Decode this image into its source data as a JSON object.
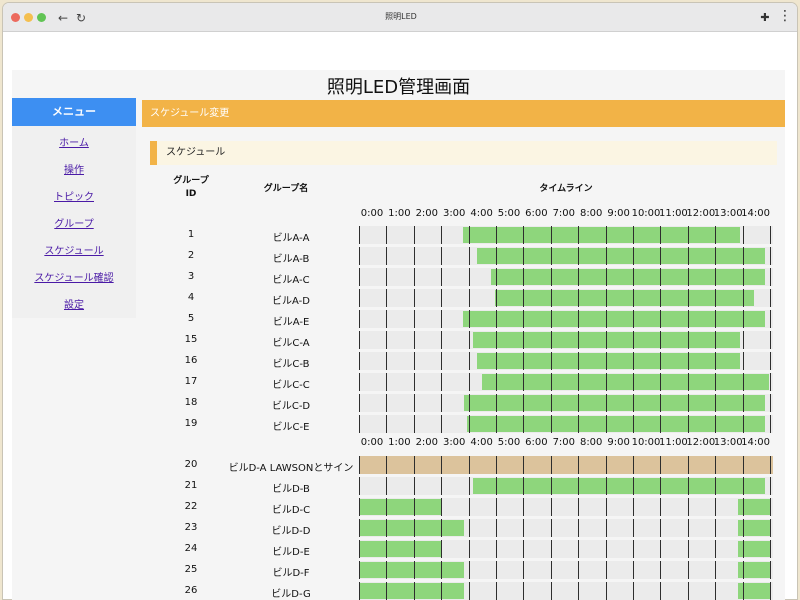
{
  "browser": {
    "title": "照明LED",
    "back_icon": "←",
    "reload_icon": "↻",
    "extension_icon": "✚"
  },
  "page": {
    "title": "照明LED管理画面"
  },
  "sidebar": {
    "heading": "メニュー",
    "items": [
      {
        "label": "ホーム"
      },
      {
        "label": "操作"
      },
      {
        "label": "トピック"
      },
      {
        "label": "グループ"
      },
      {
        "label": "スケジュール"
      },
      {
        "label": "スケジュール確認"
      },
      {
        "label": "設定"
      }
    ]
  },
  "section": {
    "heading": "スケジュール変更",
    "subheading": "スケジュール"
  },
  "table": {
    "col_id_line1": "グループ",
    "col_id_line2": "ID",
    "col_name": "グループ名",
    "col_timeline": "タイムライン",
    "hours": [
      "0:00",
      "1:00",
      "2:00",
      "3:00",
      "4:00",
      "5:00",
      "6:00",
      "7:00",
      "8:00",
      "9:00",
      "10:00",
      "11:00",
      "12:00",
      "13:00",
      "14:00"
    ],
    "group1": [
      {
        "id": "1",
        "name": "ビルA-A",
        "on": [
          {
            "start": 3.8,
            "end": 13.9
          }
        ]
      },
      {
        "id": "2",
        "name": "ビルA-B",
        "on": [
          {
            "start": 4.3,
            "end": 14.8
          }
        ]
      },
      {
        "id": "3",
        "name": "ビルA-C",
        "on": [
          {
            "start": 4.8,
            "end": 14.8
          }
        ]
      },
      {
        "id": "4",
        "name": "ビルA-D",
        "on": [
          {
            "start": 4.95,
            "end": 14.4
          }
        ]
      },
      {
        "id": "5",
        "name": "ビルA-E",
        "on": [
          {
            "start": 3.8,
            "end": 14.8
          }
        ]
      },
      {
        "id": "15",
        "name": "ビルC-A",
        "on": [
          {
            "start": 4.15,
            "end": 13.9
          }
        ]
      },
      {
        "id": "16",
        "name": "ビルC-B",
        "on": [
          {
            "start": 4.3,
            "end": 13.9
          }
        ]
      },
      {
        "id": "17",
        "name": "ビルC-C",
        "on": [
          {
            "start": 4.5,
            "end": 14.95
          }
        ]
      },
      {
        "id": "18",
        "name": "ビルC-D",
        "on": [
          {
            "start": 3.85,
            "end": 14.8
          }
        ]
      },
      {
        "id": "19",
        "name": "ビルC-E",
        "on": [
          {
            "start": 3.95,
            "end": 14.8
          }
        ]
      }
    ],
    "group2": [
      {
        "id": "20",
        "name": "ビルD-A LAWSONとサイン",
        "all_day": true,
        "on": []
      },
      {
        "id": "21",
        "name": "ビルD-B",
        "on": [
          {
            "start": 4.15,
            "end": 14.8
          }
        ]
      },
      {
        "id": "22",
        "name": "ビルD-C",
        "on": [
          {
            "start": 0,
            "end": 3.0
          },
          {
            "start": 13.85,
            "end": 15
          }
        ]
      },
      {
        "id": "23",
        "name": "ビルD-D",
        "on": [
          {
            "start": 0,
            "end": 3.85
          },
          {
            "start": 13.85,
            "end": 15
          }
        ]
      },
      {
        "id": "24",
        "name": "ビルD-E",
        "on": [
          {
            "start": 0,
            "end": 3.0
          },
          {
            "start": 13.85,
            "end": 15
          }
        ]
      },
      {
        "id": "25",
        "name": "ビルD-F",
        "on": [
          {
            "start": 0,
            "end": 3.85
          },
          {
            "start": 13.85,
            "end": 15
          }
        ]
      },
      {
        "id": "26",
        "name": "ビルD-G",
        "on": [
          {
            "start": 0,
            "end": 3.85
          },
          {
            "start": 13.85,
            "end": 15
          }
        ]
      }
    ]
  },
  "colors": {
    "on": "#8ed67c",
    "all_day": "#dcc39c",
    "off": "#ebebeb"
  }
}
